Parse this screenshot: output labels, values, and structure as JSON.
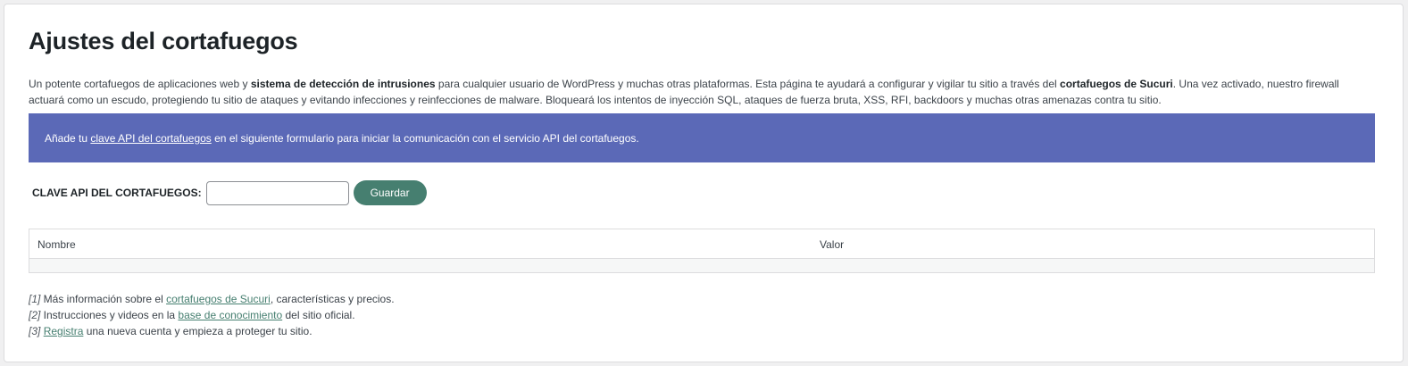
{
  "page": {
    "title": "Ajustes del cortafuegos"
  },
  "intro": {
    "part1": "Un potente cortafuegos de aplicaciones web y ",
    "bold1": "sistema de detección de intrusiones",
    "part2": " para cualquier usuario de WordPress y muchas otras plataformas. Esta página te ayudará a configurar y vigilar tu sitio a través del ",
    "bold2": "cortafuegos de Sucuri",
    "part3": ". Una vez activado, nuestro firewall actuará como un escudo, protegiendo tu sitio de ataques y evitando infecciones y reinfecciones de malware. Bloqueará los intentos de inyección SQL, ataques de fuerza bruta, XSS, RFI, backdoors y muchas otras amenazas contra tu sitio."
  },
  "banner": {
    "prefix": "Añade tu ",
    "link": "clave API del cortafuegos",
    "suffix": " en el siguiente formulario para iniciar la comunicación con el servicio API del cortafuegos.",
    "color": "#5b69b7"
  },
  "form": {
    "label": "CLAVE API DEL CORTAFUEGOS:",
    "input_value": "",
    "save_label": "Guardar",
    "button_color": "#467f70"
  },
  "table": {
    "columns": [
      "Nombre",
      "Valor"
    ],
    "rows": []
  },
  "footnotes": [
    {
      "marker": "[1]",
      "pre": " Más información sobre el ",
      "link": "cortafuegos de Sucuri",
      "post": ", características y precios."
    },
    {
      "marker": "[2]",
      "pre": " Instrucciones y videos en la ",
      "link": "base de conocimiento",
      "post": " del sitio oficial."
    },
    {
      "marker": "[3]",
      "pre": " ",
      "link": "Registra",
      "post": " una nueva cuenta y empieza a proteger tu sitio."
    }
  ]
}
